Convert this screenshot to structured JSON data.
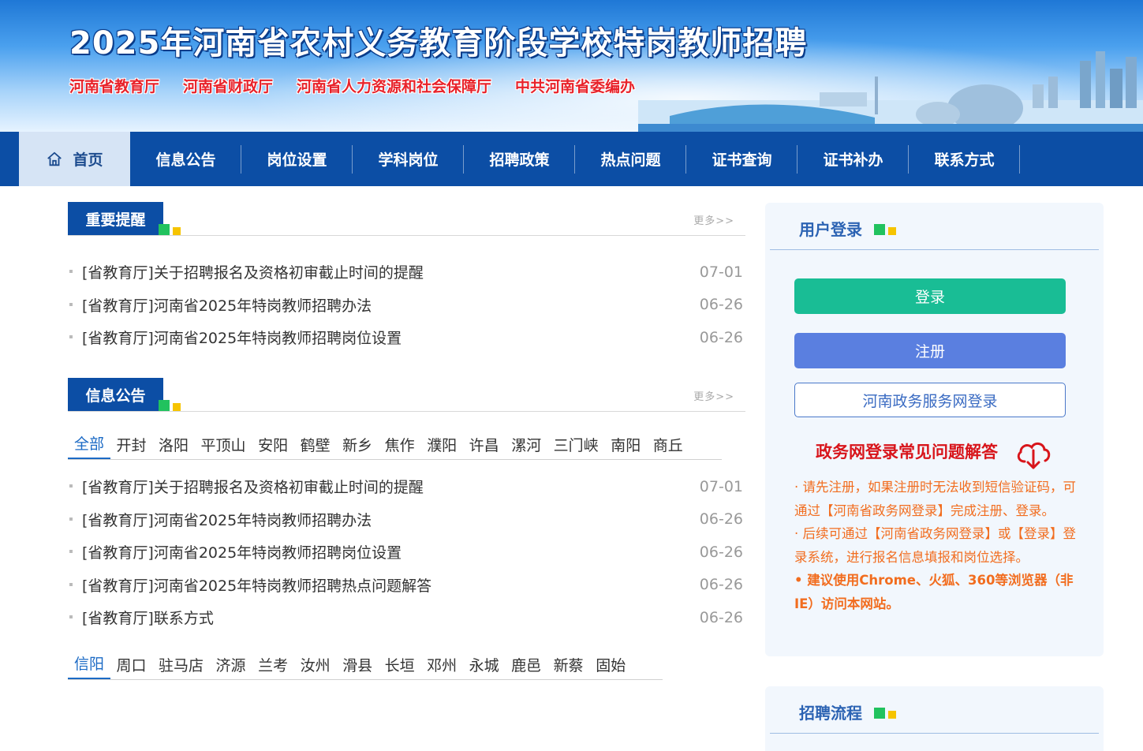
{
  "banner": {
    "title": "2025年河南省农村义务教育阶段学校特岗教师招聘",
    "orgs": [
      "河南省教育厅",
      "河南省财政厅",
      "河南省人力资源和社会保障厅",
      "中共河南省委编办"
    ]
  },
  "nav": {
    "items": [
      {
        "label": "首页",
        "icon": "home-icon"
      },
      {
        "label": "信息公告"
      },
      {
        "label": "岗位设置"
      },
      {
        "label": "学科岗位"
      },
      {
        "label": "招聘政策"
      },
      {
        "label": "热点问题"
      },
      {
        "label": "证书查询"
      },
      {
        "label": "证书补办"
      },
      {
        "label": "联系方式"
      }
    ]
  },
  "reminders": {
    "title": "重要提醒",
    "more": "更多>>",
    "items": [
      {
        "text": "[省教育厅]关于招聘报名及资格初审截止时间的提醒",
        "date": "07-01"
      },
      {
        "text": "[省教育厅]河南省2025年特岗教师招聘办法",
        "date": "06-26"
      },
      {
        "text": "[省教育厅]河南省2025年特岗教师招聘岗位设置",
        "date": "06-26"
      }
    ]
  },
  "notices": {
    "title": "信息公告",
    "more": "更多>>",
    "tabs_row1": [
      "全部",
      "开封",
      "洛阳",
      "平顶山",
      "安阳",
      "鹤壁",
      "新乡",
      "焦作",
      "濮阳",
      "许昌",
      "漯河",
      "三门峡",
      "南阳",
      "商丘"
    ],
    "tabs_row2": [
      "信阳",
      "周口",
      "驻马店",
      "济源",
      "兰考",
      "汝州",
      "滑县",
      "长垣",
      "邓州",
      "永城",
      "鹿邑",
      "新蔡",
      "固始"
    ],
    "items": [
      {
        "text": "[省教育厅]关于招聘报名及资格初审截止时间的提醒",
        "date": "07-01"
      },
      {
        "text": "[省教育厅]河南省2025年特岗教师招聘办法",
        "date": "06-26"
      },
      {
        "text": "[省教育厅]河南省2025年特岗教师招聘岗位设置",
        "date": "06-26"
      },
      {
        "text": "[省教育厅]河南省2025年特岗教师招聘热点问题解答",
        "date": "06-26"
      },
      {
        "text": "[省教育厅]联系方式",
        "date": "06-26"
      }
    ]
  },
  "login": {
    "title": "用户登录",
    "login_label": "登录",
    "register_label": "注册",
    "gov_login_label": "河南政务服务网登录",
    "faq_title": "政务网登录常见问题解答",
    "faq_icon": "cloud-download-icon",
    "note1": "· 请先注册，如果注册时无法收到短信验证码，可通过【河南省政务网登录】完成注册、登录。",
    "note2": "· 后续可通过【河南省政务网登录】或【登录】登录系统，进行报名信息填报和岗位选择。",
    "note3": "• 建议使用Chrome、火狐、360等浏览器（非IE）访问本网站。"
  },
  "process": {
    "title": "招聘流程"
  },
  "colors": {
    "nav_bg": "#0c4ea5",
    "login_btn": "#19bd95",
    "register_btn": "#5a7fe0",
    "accent_red": "#d8151b",
    "note_orange": "#f26d1f"
  }
}
